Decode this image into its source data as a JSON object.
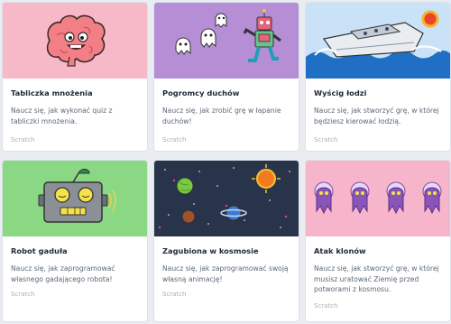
{
  "cards": [
    {
      "title": "Tabliczka mnożenia",
      "description": "Naucz się, jak wykonać quiz z tabliczki mnożenia.",
      "tag": "Scratch",
      "bg": "#f7b8c7",
      "icon": "brain-character-icon"
    },
    {
      "title": "Pogromcy duchów",
      "description": "Naucz się, jak zrobić grę w łapanie duchów!",
      "tag": "Scratch",
      "bg": "#b58ed6",
      "icon": "ghosts-and-robot-icon"
    },
    {
      "title": "Wyścig łodzi",
      "description": "Naucz się, jak stworzyć grę, w której będziesz kierować łodzią.",
      "tag": "Scratch",
      "bg": "#c9e2f7",
      "icon": "boat-on-waves-icon"
    },
    {
      "title": "Robot gaduła",
      "description": "Naucz się, jak zaprogramować własnego gadającego robota!",
      "tag": "Scratch",
      "bg": "#8ad883",
      "icon": "talking-robot-icon"
    },
    {
      "title": "Zagubiona w kosmosie",
      "description": "Naucz się, jak zaprogramować swoją własną animację!",
      "tag": "Scratch",
      "bg": "#28344a",
      "icon": "space-planets-icon"
    },
    {
      "title": "Atak klonów",
      "description": "Naucz się, jak stworzyć grę, w której musisz uratować Ziemię przed potworami z kosmosu.",
      "tag": "Scratch",
      "bg": "#f7b5cc",
      "icon": "alien-clones-icon"
    }
  ]
}
